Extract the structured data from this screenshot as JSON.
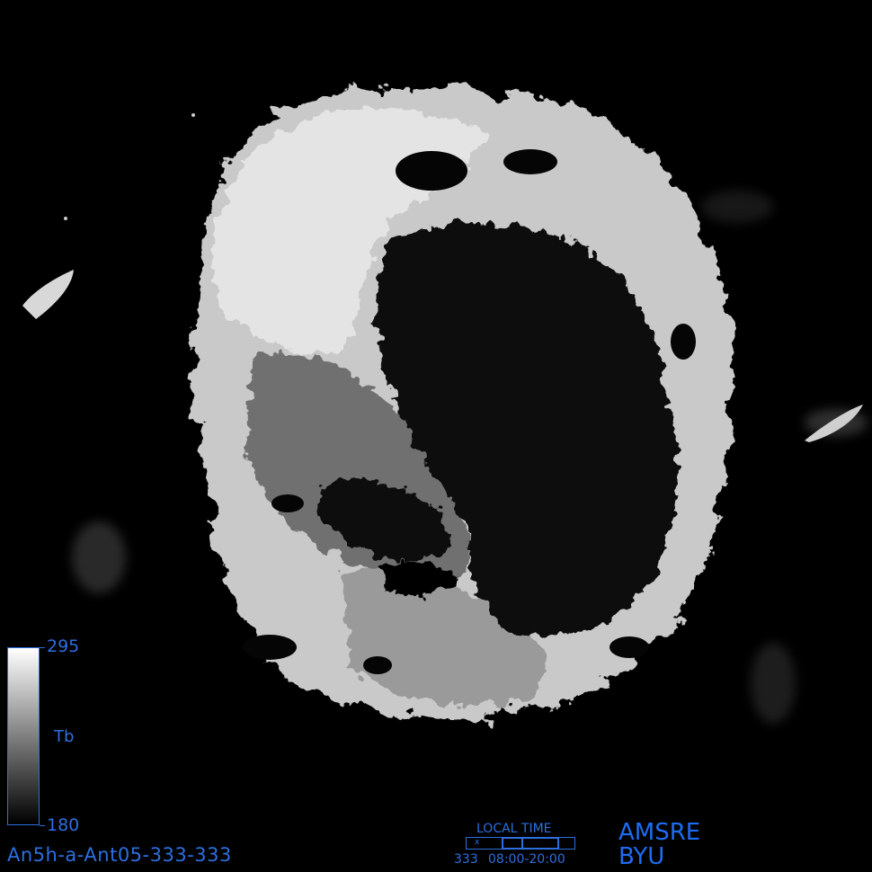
{
  "image": {
    "description_icon": "antarctic-brightness-temperature-map",
    "colors": {
      "annotation": "#2d6fe0",
      "background": "#000000",
      "ice_high": "#e8e8e8",
      "ice_low": "#1a1a1a"
    }
  },
  "colorbar": {
    "max_label": "295",
    "min_label": "180",
    "quantity_label": "Tb"
  },
  "local_time": {
    "title": "LOCAL TIME",
    "day": "333",
    "range": "08:00-20:00",
    "marker": "x"
  },
  "branding": {
    "sensor": "AMSRE",
    "org": "BYU"
  },
  "filename": "An5h-a-Ant05-333-333"
}
